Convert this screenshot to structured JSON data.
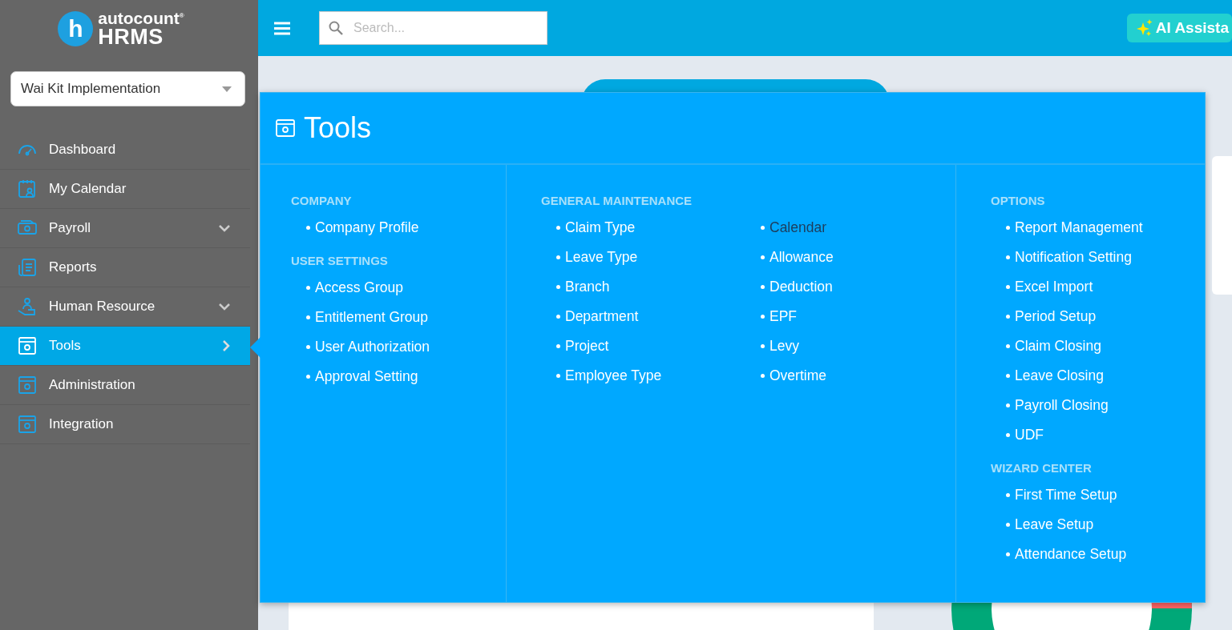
{
  "sidebar": {
    "logo": {
      "brand_top": "autocount",
      "brand_mark": "®",
      "brand_bottom": "HRMS",
      "badge": "h"
    },
    "company_select": {
      "value": "Wai Kit Implementation"
    },
    "items": [
      {
        "label": "Dashboard",
        "selected": false
      },
      {
        "label": "My Calendar",
        "selected": false
      },
      {
        "label": "Payroll",
        "selected": false,
        "has_children": true
      },
      {
        "label": "Reports",
        "selected": false
      },
      {
        "label": "Human Resource",
        "selected": false,
        "has_children": true
      },
      {
        "label": "Tools",
        "selected": true,
        "has_children": true
      },
      {
        "label": "Administration",
        "selected": false
      },
      {
        "label": "Integration",
        "selected": false
      }
    ]
  },
  "topbar": {
    "search": {
      "placeholder": "Search..."
    },
    "ai_button": "AI Assista"
  },
  "tools_menu": {
    "title": "Tools",
    "columns": [
      {
        "sections": [
          {
            "heading": "COMPANY",
            "items": [
              {
                "label": "Company Profile",
                "highlighted": false
              }
            ]
          },
          {
            "heading": "USER SETTINGS",
            "items": [
              {
                "label": "Access Group",
                "highlighted": false
              },
              {
                "label": "Entitlement Group",
                "highlighted": false
              },
              {
                "label": "User Authorization",
                "highlighted": false
              },
              {
                "label": "Approval Setting",
                "highlighted": false
              }
            ]
          }
        ]
      },
      {
        "sections": [
          {
            "heading": "GENERAL MAINTENANCE",
            "items": [
              {
                "label": "Claim Type",
                "highlighted": false
              },
              {
                "label": "Leave Type",
                "highlighted": false
              },
              {
                "label": "Branch",
                "highlighted": false
              },
              {
                "label": "Department",
                "highlighted": false
              },
              {
                "label": "Project",
                "highlighted": false
              },
              {
                "label": "Employee Type",
                "highlighted": false
              },
              {
                "label": "Calendar",
                "highlighted": true
              },
              {
                "label": "Allowance",
                "highlighted": false
              },
              {
                "label": "Deduction",
                "highlighted": false
              },
              {
                "label": "EPF",
                "highlighted": false
              },
              {
                "label": "Levy",
                "highlighted": false
              },
              {
                "label": "Overtime",
                "highlighted": false
              }
            ]
          }
        ]
      },
      {
        "sections": [
          {
            "heading": "OPTIONS",
            "items": [
              {
                "label": "Report Management",
                "highlighted": false
              },
              {
                "label": "Notification Setting",
                "highlighted": false
              },
              {
                "label": "Excel Import",
                "highlighted": false
              },
              {
                "label": "Period Setup",
                "highlighted": false
              },
              {
                "label": "Claim Closing",
                "highlighted": false
              },
              {
                "label": "Leave Closing",
                "highlighted": false
              },
              {
                "label": "Payroll Closing",
                "highlighted": false
              },
              {
                "label": "UDF",
                "highlighted": false
              }
            ]
          },
          {
            "heading": "WIZARD CENTER",
            "items": [
              {
                "label": "First Time Setup",
                "highlighted": false
              },
              {
                "label": "Leave Setup",
                "highlighted": false
              },
              {
                "label": "Attendance Setup",
                "highlighted": false
              }
            ]
          }
        ]
      }
    ]
  }
}
